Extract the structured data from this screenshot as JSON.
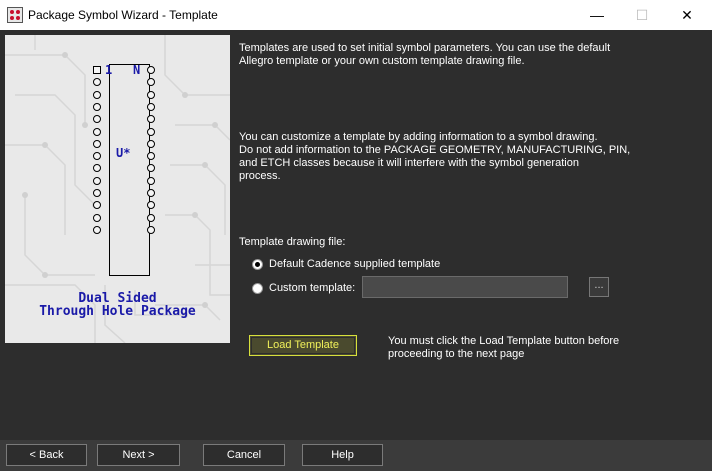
{
  "window": {
    "title": "Package Symbol Wizard - Template",
    "minimize_glyph": "—",
    "maximize_glyph": "☐",
    "close_glyph": "✕",
    "icon": "cadence-app-icon"
  },
  "illustration": {
    "pin1_label": "1",
    "pinN_label": "N",
    "refdes_label": "U*",
    "package_line1": "Dual Sided",
    "package_line2": "Through Hole Package",
    "pins_per_side": 14
  },
  "intro_text": {
    "line1": "Templates are used to set initial symbol parameters. You can use the default",
    "line2": "Allegro template or your own custom template drawing file."
  },
  "customize_text": {
    "line1": "You can customize a template by adding information to a symbol drawing.",
    "line2": "Do not add information to the PACKAGE GEOMETRY, MANUFACTURING, PIN,",
    "line3": "and ETCH classes because it will interfere with the symbol generation",
    "line4": "process."
  },
  "template": {
    "label": "Template drawing file:",
    "option_default": "Default Cadence supplied template",
    "option_custom": "Custom template:",
    "selected": "default",
    "custom_path_value": "",
    "browse_label": "..."
  },
  "load": {
    "button_label": "Load Template",
    "note_line1": "You must click the Load Template button before",
    "note_line2": "proceeding to the next page"
  },
  "footer": {
    "back_label": "< Back",
    "next_label": "Next >",
    "cancel_label": "Cancel",
    "help_label": "Help"
  }
}
